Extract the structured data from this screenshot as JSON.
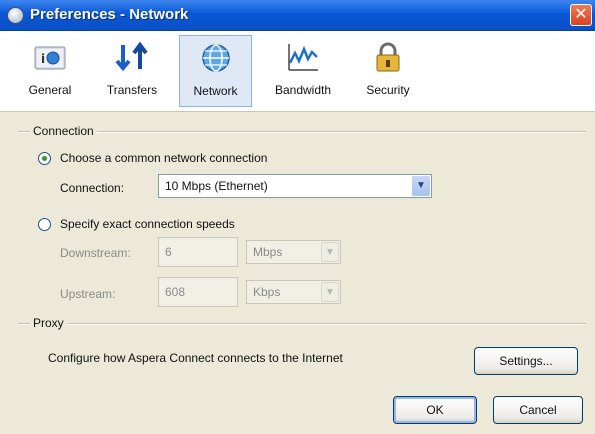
{
  "window": {
    "title": "Preferences - Network",
    "close_glyph": "✕"
  },
  "toolbar": {
    "items": [
      {
        "label": "General",
        "icon": "info-card-icon"
      },
      {
        "label": "Transfers",
        "icon": "up-down-arrows-icon"
      },
      {
        "label": "Network",
        "icon": "globe-icon",
        "active": true
      },
      {
        "label": "Bandwidth",
        "icon": "bandwidth-graph-icon"
      },
      {
        "label": "Security",
        "icon": "padlock-icon"
      }
    ]
  },
  "connection": {
    "group_label": "Connection",
    "common_option": {
      "label": "Choose a common network connection",
      "checked": true
    },
    "connection_label": "Connection:",
    "connection_value": "10 Mbps (Ethernet)",
    "exact_option": {
      "label": "Specify exact connection speeds",
      "checked": false
    },
    "downstream": {
      "label": "Downstream:",
      "value": "6",
      "unit": "Mbps"
    },
    "upstream": {
      "label": "Upstream:",
      "value": "608",
      "unit": "Kbps"
    }
  },
  "proxy": {
    "group_label": "Proxy",
    "description": "Configure how Aspera Connect connects to the Internet",
    "settings_label": "Settings..."
  },
  "footer": {
    "ok_label": "OK",
    "cancel_label": "Cancel"
  },
  "colors": {
    "title_bar": "#0a58d6",
    "dialog_bg": "#ece9d8",
    "active_tab": "#dfe9f6"
  }
}
